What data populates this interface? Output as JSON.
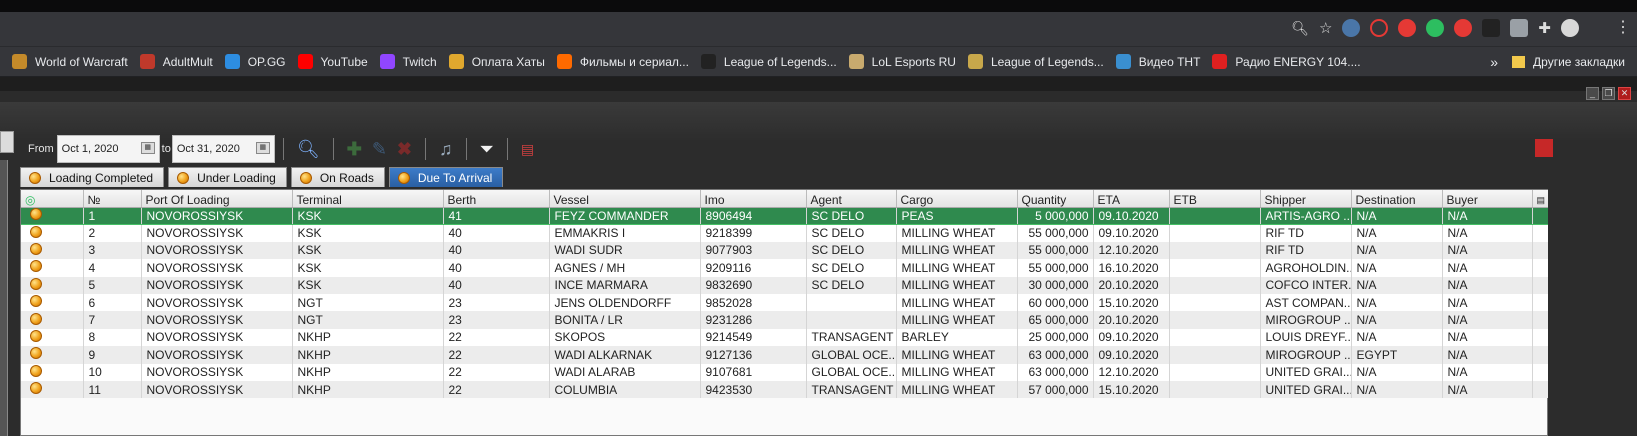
{
  "browser": {
    "bookmarks": [
      {
        "label": "World of Warcraft",
        "icon": "wow-icon",
        "color": "#c48a2a"
      },
      {
        "label": "AdultMult",
        "icon": "adultmult-icon",
        "color": "#c0392b"
      },
      {
        "label": "OP.GG",
        "icon": "opgg-icon",
        "color": "#2d8de1"
      },
      {
        "label": "YouTube",
        "icon": "youtube-icon",
        "color": "#ff0000"
      },
      {
        "label": "Twitch",
        "icon": "twitch-icon",
        "color": "#9146ff"
      },
      {
        "label": "Оплата Хаты",
        "icon": "gear-icon",
        "color": "#e0a82e"
      },
      {
        "label": "Фильмы и сериал...",
        "icon": "hd-icon",
        "color": "#ff6a00"
      },
      {
        "label": "League of Legends...",
        "icon": "pb-icon",
        "color": "#222222"
      },
      {
        "label": "LoL Esports RU",
        "icon": "lol-esports-icon",
        "color": "#c8aa6e"
      },
      {
        "label": "League of Legends...",
        "icon": "lol-icon",
        "color": "#c8a84b"
      },
      {
        "label": "Видео ТНТ",
        "icon": "tnt-icon",
        "color": "#3a8fd0"
      },
      {
        "label": "Радио ENERGY 104....",
        "icon": "energy-icon",
        "color": "#e02020"
      }
    ],
    "more_label": "»",
    "other_bookmarks": "Другие закладки"
  },
  "filter": {
    "from_label": "From",
    "from_value": "Oct 1, 2020",
    "to_label": "to",
    "to_value": "Oct 31, 2020"
  },
  "tabs": [
    {
      "label": "Loading Completed",
      "active": false
    },
    {
      "label": "Under Loading",
      "active": false
    },
    {
      "label": "On Roads",
      "active": false
    },
    {
      "label": "Due To Arrival",
      "active": true
    }
  ],
  "grid": {
    "columns": [
      "№",
      "Port Of Loading",
      "Terminal",
      "Berth",
      "Vessel",
      "Imo",
      "Agent",
      "Cargo",
      "Quantity",
      "ETA",
      "ETB",
      "Shipper",
      "Destination",
      "Buyer"
    ],
    "rows": [
      [
        "1",
        "NOVOROSSIYSK",
        "KSK",
        "41",
        "FEYZ COMMANDER",
        "8906494",
        "SC DELO",
        "PEAS",
        "5 000,000",
        "09.10.2020",
        "",
        "ARTIS-AGRO ...",
        "N/A",
        "N/A"
      ],
      [
        "2",
        "NOVOROSSIYSK",
        "KSK",
        "40",
        "EMMAKRIS I",
        "9218399",
        "SC DELO",
        "MILLING WHEAT",
        "55 000,000",
        "09.10.2020",
        "",
        "RIF TD",
        "N/A",
        "N/A"
      ],
      [
        "3",
        "NOVOROSSIYSK",
        "KSK",
        "40",
        "WADI SUDR",
        "9077903",
        "SC DELO",
        "MILLING WHEAT",
        "55 000,000",
        "12.10.2020",
        "",
        "RIF TD",
        "N/A",
        "N/A"
      ],
      [
        "4",
        "NOVOROSSIYSK",
        "KSK",
        "40",
        "AGNES / MH",
        "9209116",
        "SC DELO",
        "MILLING WHEAT",
        "55 000,000",
        "16.10.2020",
        "",
        "AGROHOLDIN...",
        "N/A",
        "N/A"
      ],
      [
        "5",
        "NOVOROSSIYSK",
        "KSK",
        "40",
        "INCE MARMARA",
        "9832690",
        "SC DELO",
        "MILLING WHEAT",
        "30 000,000",
        "20.10.2020",
        "",
        "COFCO INTER...",
        "N/A",
        "N/A"
      ],
      [
        "6",
        "NOVOROSSIYSK",
        "NGT",
        "23",
        "JENS OLDENDORFF",
        "9852028",
        "",
        "MILLING WHEAT",
        "60 000,000",
        "15.10.2020",
        "",
        "AST COMPAN...",
        "N/A",
        "N/A"
      ],
      [
        "7",
        "NOVOROSSIYSK",
        "NGT",
        "23",
        "BONITA / LR",
        "9231286",
        "",
        "MILLING WHEAT",
        "65 000,000",
        "20.10.2020",
        "",
        "MIROGROUP ...",
        "N/A",
        "N/A"
      ],
      [
        "8",
        "NOVOROSSIYSK",
        "NKHP",
        "22",
        "SKOPOS",
        "9214549",
        "TRANSAGENT",
        "BARLEY",
        "25 000,000",
        "09.10.2020",
        "",
        "LOUIS DREYF...",
        "N/A",
        "N/A"
      ],
      [
        "9",
        "NOVOROSSIYSK",
        "NKHP",
        "22",
        "WADI ALKARNAK",
        "9127136",
        "GLOBAL OCE...",
        "MILLING WHEAT",
        "63 000,000",
        "09.10.2020",
        "",
        "MIROGROUP ...",
        "EGYPT",
        "N/A"
      ],
      [
        "10",
        "NOVOROSSIYSK",
        "NKHP",
        "22",
        "WADI ALARAB",
        "9107681",
        "GLOBAL OCE...",
        "MILLING WHEAT",
        "63 000,000",
        "12.10.2020",
        "",
        "UNITED GRAI...",
        "N/A",
        "N/A"
      ],
      [
        "11",
        "NOVOROSSIYSK",
        "NKHP",
        "22",
        "COLUMBIA",
        "9423530",
        "TRANSAGENT",
        "MILLING WHEAT",
        "57 000,000",
        "15.10.2020",
        "",
        "UNITED GRAI...",
        "N/A",
        "N/A"
      ]
    ],
    "selected_row": 0
  },
  "colors": {
    "selected_row": "#2f8a4e",
    "active_tab": "#2a5fa3"
  }
}
